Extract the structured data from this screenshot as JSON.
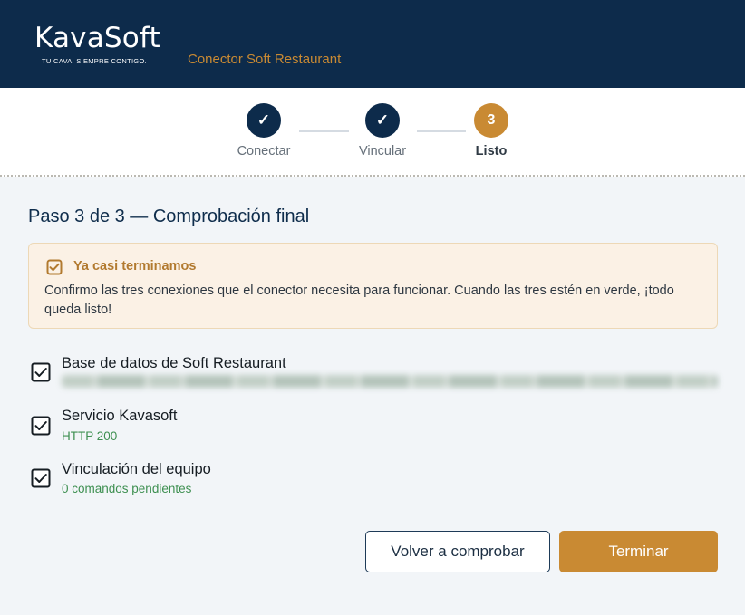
{
  "header": {
    "logo": "KavaSoft",
    "tagline": "TU CAVA, SIEMPRE CONTIGO.",
    "app_name": "Conector Soft Restaurant",
    "background": "#0d2b4b",
    "accent": "#c98a33"
  },
  "stepper": {
    "steps": [
      {
        "label": "Conectar",
        "marker": "✓",
        "state": "done"
      },
      {
        "label": "Vincular",
        "marker": "✓",
        "state": "done"
      },
      {
        "label": "Listo",
        "marker": "3",
        "state": "active"
      }
    ]
  },
  "main": {
    "title": "Paso 3 de 3 — Comprobación final",
    "notice": {
      "icon": "checkbox-checked-icon",
      "title": "Ya casi terminamos",
      "text": "Confirmo las tres conexiones que el conector necesita para funcionar. Cuando las tres estén en verde, ¡todo queda listo!"
    },
    "checks": [
      {
        "title": "Base de datos de Soft Restaurant",
        "status": "",
        "icon": "checkbox-checked-icon"
      },
      {
        "title": "Servicio Kavasoft",
        "status": "HTTP 200",
        "icon": "checkbox-checked-icon"
      },
      {
        "title": "Vinculación del equipo",
        "status": "0 comandos pendientes",
        "icon": "checkbox-checked-icon"
      }
    ]
  },
  "actions": {
    "recheck_label": "Volver a comprobar",
    "finish_label": "Terminar"
  }
}
